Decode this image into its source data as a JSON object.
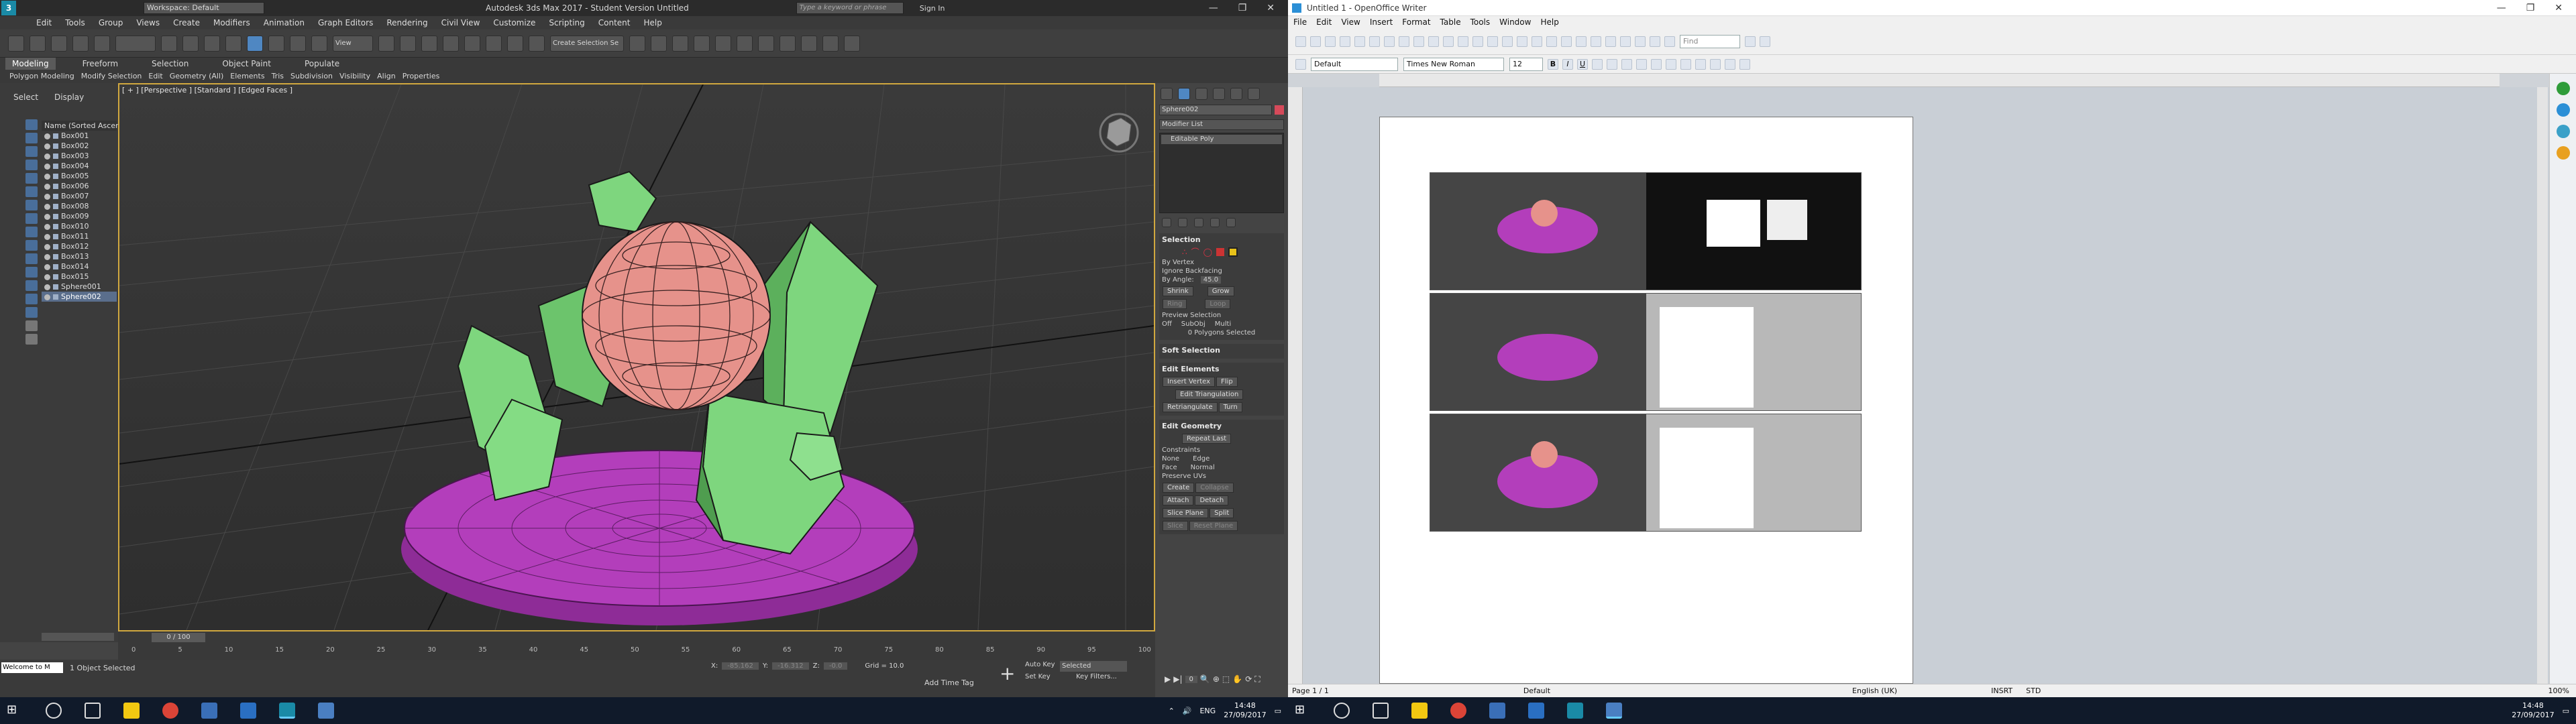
{
  "max": {
    "title": "Autodesk 3ds Max 2017 - Student Version   Untitled",
    "workspace": "Workspace: Default",
    "search_placeholder": "Type a keyword or phrase",
    "sign_in": "Sign In",
    "menu": [
      "Edit",
      "Tools",
      "Group",
      "Views",
      "Create",
      "Modifiers",
      "Animation",
      "Graph Editors",
      "Rendering",
      "Civil View",
      "Customize",
      "Scripting",
      "Content",
      "Help"
    ],
    "view_combo": "View",
    "selection_set": "Create Selection Se",
    "ribbon_tabs": [
      "Modeling",
      "Freeform",
      "Selection",
      "Object Paint",
      "Populate"
    ],
    "ribbon_sub": [
      "Polygon Modeling",
      "Modify Selection",
      "Edit",
      "Geometry (All)",
      "Elements",
      "Tris",
      "Subdivision",
      "Visibility",
      "Align",
      "Properties"
    ],
    "scene_tabs": [
      "Select",
      "Display"
    ],
    "scene_header": "Name (Sorted Ascen",
    "scene_items": [
      "Box001",
      "Box002",
      "Box003",
      "Box004",
      "Box005",
      "Box006",
      "Box007",
      "Box008",
      "Box009",
      "Box010",
      "Box011",
      "Box012",
      "Box013",
      "Box014",
      "Box015",
      "Sphere001",
      "Sphere002"
    ],
    "viewport_label": "[ + ] [Perspective ] [Standard ] [Edged Faces ]",
    "object_name": "Sphere002",
    "modifier_list": "Modifier List",
    "stack_item": "Editable Poly",
    "selection": {
      "title": "Selection",
      "by_vertex": "By Vertex",
      "ignore_backfacing": "Ignore Backfacing",
      "by_angle": "By Angle:",
      "angle_value": "45.0",
      "shrink": "Shrink",
      "grow": "Grow",
      "ring": "Ring",
      "loop": "Loop",
      "preview": "Preview Selection",
      "off": "Off",
      "subobj": "SubObj",
      "multi": "Multi",
      "status": "0 Polygons Selected"
    },
    "soft_selection": "Soft Selection",
    "edit_elements": {
      "title": "Edit Elements",
      "insert_vertex": "Insert Vertex",
      "flip": "Flip",
      "edit_triangulation": "Edit Triangulation",
      "retriangulate": "Retriangulate",
      "turn": "Turn"
    },
    "edit_geometry": {
      "title": "Edit Geometry",
      "repeat_last": "Repeat Last",
      "constraints": "Constraints",
      "none": "None",
      "edge": "Edge",
      "face": "Face",
      "normal": "Normal",
      "preserve_uvs": "Preserve UVs",
      "create": "Create",
      "collapse": "Collapse",
      "attach": "Attach",
      "detach": "Detach",
      "slice_plane": "Slice Plane",
      "split": "Split",
      "slice": "Slice",
      "reset_plane": "Reset Plane"
    },
    "timeline": "0 / 100",
    "ticks": [
      "0",
      "5",
      "10",
      "15",
      "20",
      "25",
      "30",
      "35",
      "40",
      "45",
      "50",
      "55",
      "60",
      "65",
      "70",
      "75",
      "80",
      "85",
      "90",
      "95",
      "100"
    ],
    "status_welcome": "Welcome to M",
    "status_selected": "1 Object Selected",
    "coords": {
      "x_label": "X:",
      "x": "-85.162",
      "y_label": "Y:",
      "y": "-16.312",
      "z_label": "Z:",
      "z": "-0.0"
    },
    "grid": "Grid = 10.0",
    "add_time_tag": "Add Time Tag",
    "auto_key": "Auto Key",
    "set_key": "Set Key",
    "key_mode": "Selected",
    "key_filters": "Key Filters...",
    "frame": "0"
  },
  "writer": {
    "title": "Untitled 1 - OpenOffice Writer",
    "menu": [
      "File",
      "Edit",
      "View",
      "Insert",
      "Format",
      "Table",
      "Tools",
      "Window",
      "Help"
    ],
    "find_placeholder": "Find",
    "style": "Default",
    "font": "Times New Roman",
    "size": "12",
    "page_info": "Page 1 / 1",
    "page_style": "Default",
    "language": "English (UK)",
    "insert_mode": "INSRT",
    "selection_mode": "STD",
    "zoom": "100%"
  },
  "taskbar": {
    "lang": "ENG",
    "time": "14:48",
    "date": "27/09/2017"
  },
  "colors": {
    "sphere": "#e6928b",
    "crystal": "#7ed67e",
    "base": "#b33ebb",
    "accent": "#d1a83f"
  }
}
